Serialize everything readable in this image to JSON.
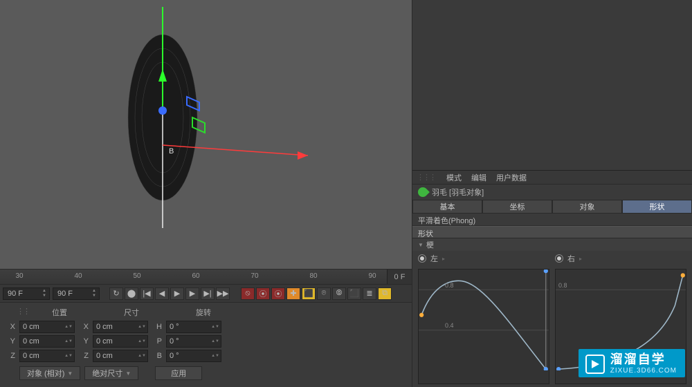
{
  "viewport": {
    "axis_label": "B"
  },
  "timeline": {
    "ticks": [
      30,
      40,
      50,
      60,
      70,
      80,
      90
    ],
    "end_cap": "0 F",
    "frame_field_left": "90 F",
    "frame_field_right": "90 F"
  },
  "transport": {
    "icons": {
      "loop": "↻",
      "rec": "⬤",
      "first": "|◀",
      "prev": "◀",
      "play": "▶",
      "next": "▶",
      "last": "▶|",
      "end": "▶▶"
    }
  },
  "key_toolbar": {
    "items": [
      "⦸",
      "⦿",
      "⦿",
      "✚",
      "⬛",
      "⌾",
      "⦾",
      "⬛",
      "≣",
      "⧉"
    ]
  },
  "coords": {
    "headers": {
      "position": "位置",
      "size": "尺寸",
      "rotation": "旋转"
    },
    "rows": [
      {
        "axis": "X",
        "pos": "0 cm",
        "size_axis": "X",
        "size": "0 cm",
        "rot_axis": "H",
        "rot": "0 °"
      },
      {
        "axis": "Y",
        "pos": "0 cm",
        "size_axis": "Y",
        "size": "0 cm",
        "rot_axis": "P",
        "rot": "0 °"
      },
      {
        "axis": "Z",
        "pos": "0 cm",
        "size_axis": "Z",
        "size": "0 cm",
        "rot_axis": "B",
        "rot": "0 °"
      }
    ],
    "buttons": {
      "object_rel": "对象 (相对)",
      "abs_size": "绝对尺寸",
      "apply": "应用"
    }
  },
  "right": {
    "menu": {
      "mode": "模式",
      "edit": "编辑",
      "user_data": "用户数据"
    },
    "object_title": "羽毛 [羽毛对象]",
    "tabs": {
      "basic": "基本",
      "coord": "坐标",
      "object": "对象",
      "shape": "形状"
    },
    "phong": "平滑着色(Phong)",
    "shape_section": "形状",
    "sub_section": "梗",
    "radios": {
      "left": "左",
      "right": "右"
    },
    "graph_ticks": {
      "y1": "0.8",
      "y2": "0.4",
      "ry1": "0.8"
    }
  },
  "watermark": {
    "cn": "溜溜自学",
    "url": "ZIXUE.3D66.COM"
  },
  "chart_data": [
    {
      "type": "line",
      "title": "左",
      "xlim": [
        0,
        1
      ],
      "ylim": [
        0,
        1
      ],
      "x": [
        0.0,
        0.1,
        0.2,
        0.3,
        0.4,
        0.6,
        0.8,
        1.0
      ],
      "values": [
        0.55,
        0.8,
        0.9,
        0.9,
        0.8,
        0.5,
        0.2,
        0.0
      ],
      "ylabel_ticks": [
        0.4,
        0.8
      ]
    },
    {
      "type": "line",
      "title": "右",
      "xlim": [
        0,
        1
      ],
      "ylim": [
        0,
        1
      ],
      "x": [
        0.0,
        0.2,
        0.4,
        0.6,
        0.8,
        0.9,
        1.0
      ],
      "values": [
        0.0,
        0.03,
        0.06,
        0.12,
        0.28,
        0.55,
        0.95
      ],
      "ylabel_ticks": [
        0.8
      ]
    }
  ]
}
